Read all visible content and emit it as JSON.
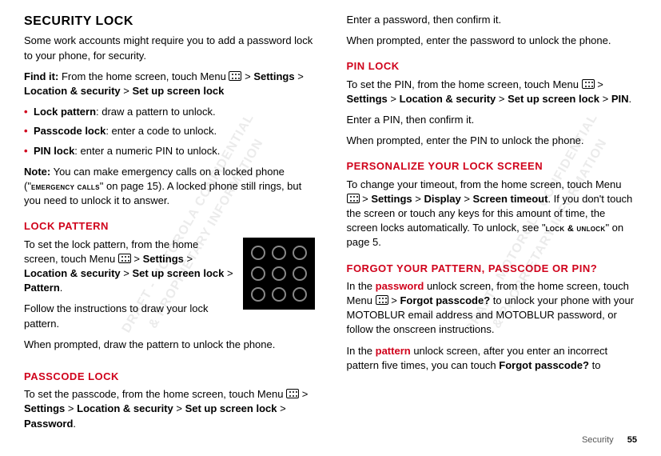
{
  "left": {
    "h1": "Security lock",
    "intro": "Some work accounts might require you to add a password lock to your phone, for security.",
    "findit_label": "Find it:",
    "findit_1": " From the home screen, touch Menu ",
    "findit_2": " > ",
    "findit_settings": "Settings",
    "findit_3": " > ",
    "findit_locsec": "Location & security",
    "findit_4": " > ",
    "findit_setup": "Set up screen lock",
    "bullet1_b": "Lock pattern",
    "bullet1_t": ": draw a pattern to unlock.",
    "bullet2_b": "Passcode lock",
    "bullet2_t": ": enter a code to unlock.",
    "bullet3_b": "PIN lock",
    "bullet3_t": ": enter a numeric PIN to unlock.",
    "note_label": "Note:",
    "note_1": " You can make emergency calls on a locked phone (\"",
    "note_sc": "emergency calls",
    "note_2": "\" on page 15). A locked phone still rings, but you need to unlock it to answer.",
    "h2_lockpattern": "Lock pattern",
    "lp_1a": "To set the lock pattern, from the home screen, touch Menu ",
    "lp_1b": " > ",
    "lp_settings": "Settings",
    "lp_1c": " > ",
    "lp_locsec": "Location & security",
    "lp_1d": " > ",
    "lp_setup": "Set up screen lock",
    "lp_1e": " > ",
    "lp_pattern": "Pattern",
    "lp_1f": ".",
    "lp_p2": "Follow the instructions to draw your lock pattern.",
    "lp_p3": "When prompted, draw the pattern to unlock the phone.",
    "h2_passcode": "Passcode lock",
    "pc_1a": "To set the passcode, from the home screen, touch Menu ",
    "pc_1b": " > ",
    "pc_settings": "Settings",
    "pc_1c": " > ",
    "pc_locsec": "Location & security",
    "pc_1d": " > ",
    "pc_setup": "Set up screen lock",
    "pc_1e": " > ",
    "pc_password": "Password",
    "pc_1f": "."
  },
  "right": {
    "p1": "Enter a password, then confirm it.",
    "p2": "When prompted, enter the password to unlock the phone.",
    "h2_pin": "PIN lock",
    "pin_1a": "To set the PIN, from the home screen, touch Menu ",
    "pin_1b": " > ",
    "pin_settings": "Settings",
    "pin_1c": " > ",
    "pin_locsec": "Location & security",
    "pin_1d": " > ",
    "pin_setup": "Set up screen lock",
    "pin_1e": " > ",
    "pin_pin": "PIN",
    "pin_1f": ".",
    "pin_p2": "Enter a PIN, then confirm it.",
    "pin_p3": "When prompted, enter the PIN to unlock the phone.",
    "h2_personalize": "Personalize your lock screen",
    "pers_1a": "To change your timeout, from the home screen, touch Menu ",
    "pers_1b": " > ",
    "pers_settings": "Settings",
    "pers_1c": " > ",
    "pers_display": "Display",
    "pers_1d": " > ",
    "pers_timeout": "Screen timeout",
    "pers_1e": ". If you don't touch the screen or touch any keys for this amount of time, the screen locks automatically. To unlock, see \"",
    "pers_sc": "lock & unlock",
    "pers_1f": "\" on page 5.",
    "h2_forgot": "Forgot your pattern, passcode or PIN?",
    "fg_1a": "In the ",
    "fg_password": "password",
    "fg_1b": " unlock screen, from the home screen, touch Menu ",
    "fg_1c": " > ",
    "fg_forgot": "Forgot passcode?",
    "fg_1d": " to unlock your phone with your MOTOBLUR email address and MOTOBLUR password, or follow the onscreen instructions.",
    "fg_2a": "In the ",
    "fg_pattern": "pattern",
    "fg_2b": " unlock screen, after you enter an incorrect pattern five times, you can touch ",
    "fg_forgot2": "Forgot passcode?",
    "fg_2c": " to"
  },
  "footer": {
    "section": "Security",
    "page": "55"
  },
  "watermark": "DRAFT - MOTOROLA CONFIDENTIAL\n& PROPRIETARY INFORMATION"
}
